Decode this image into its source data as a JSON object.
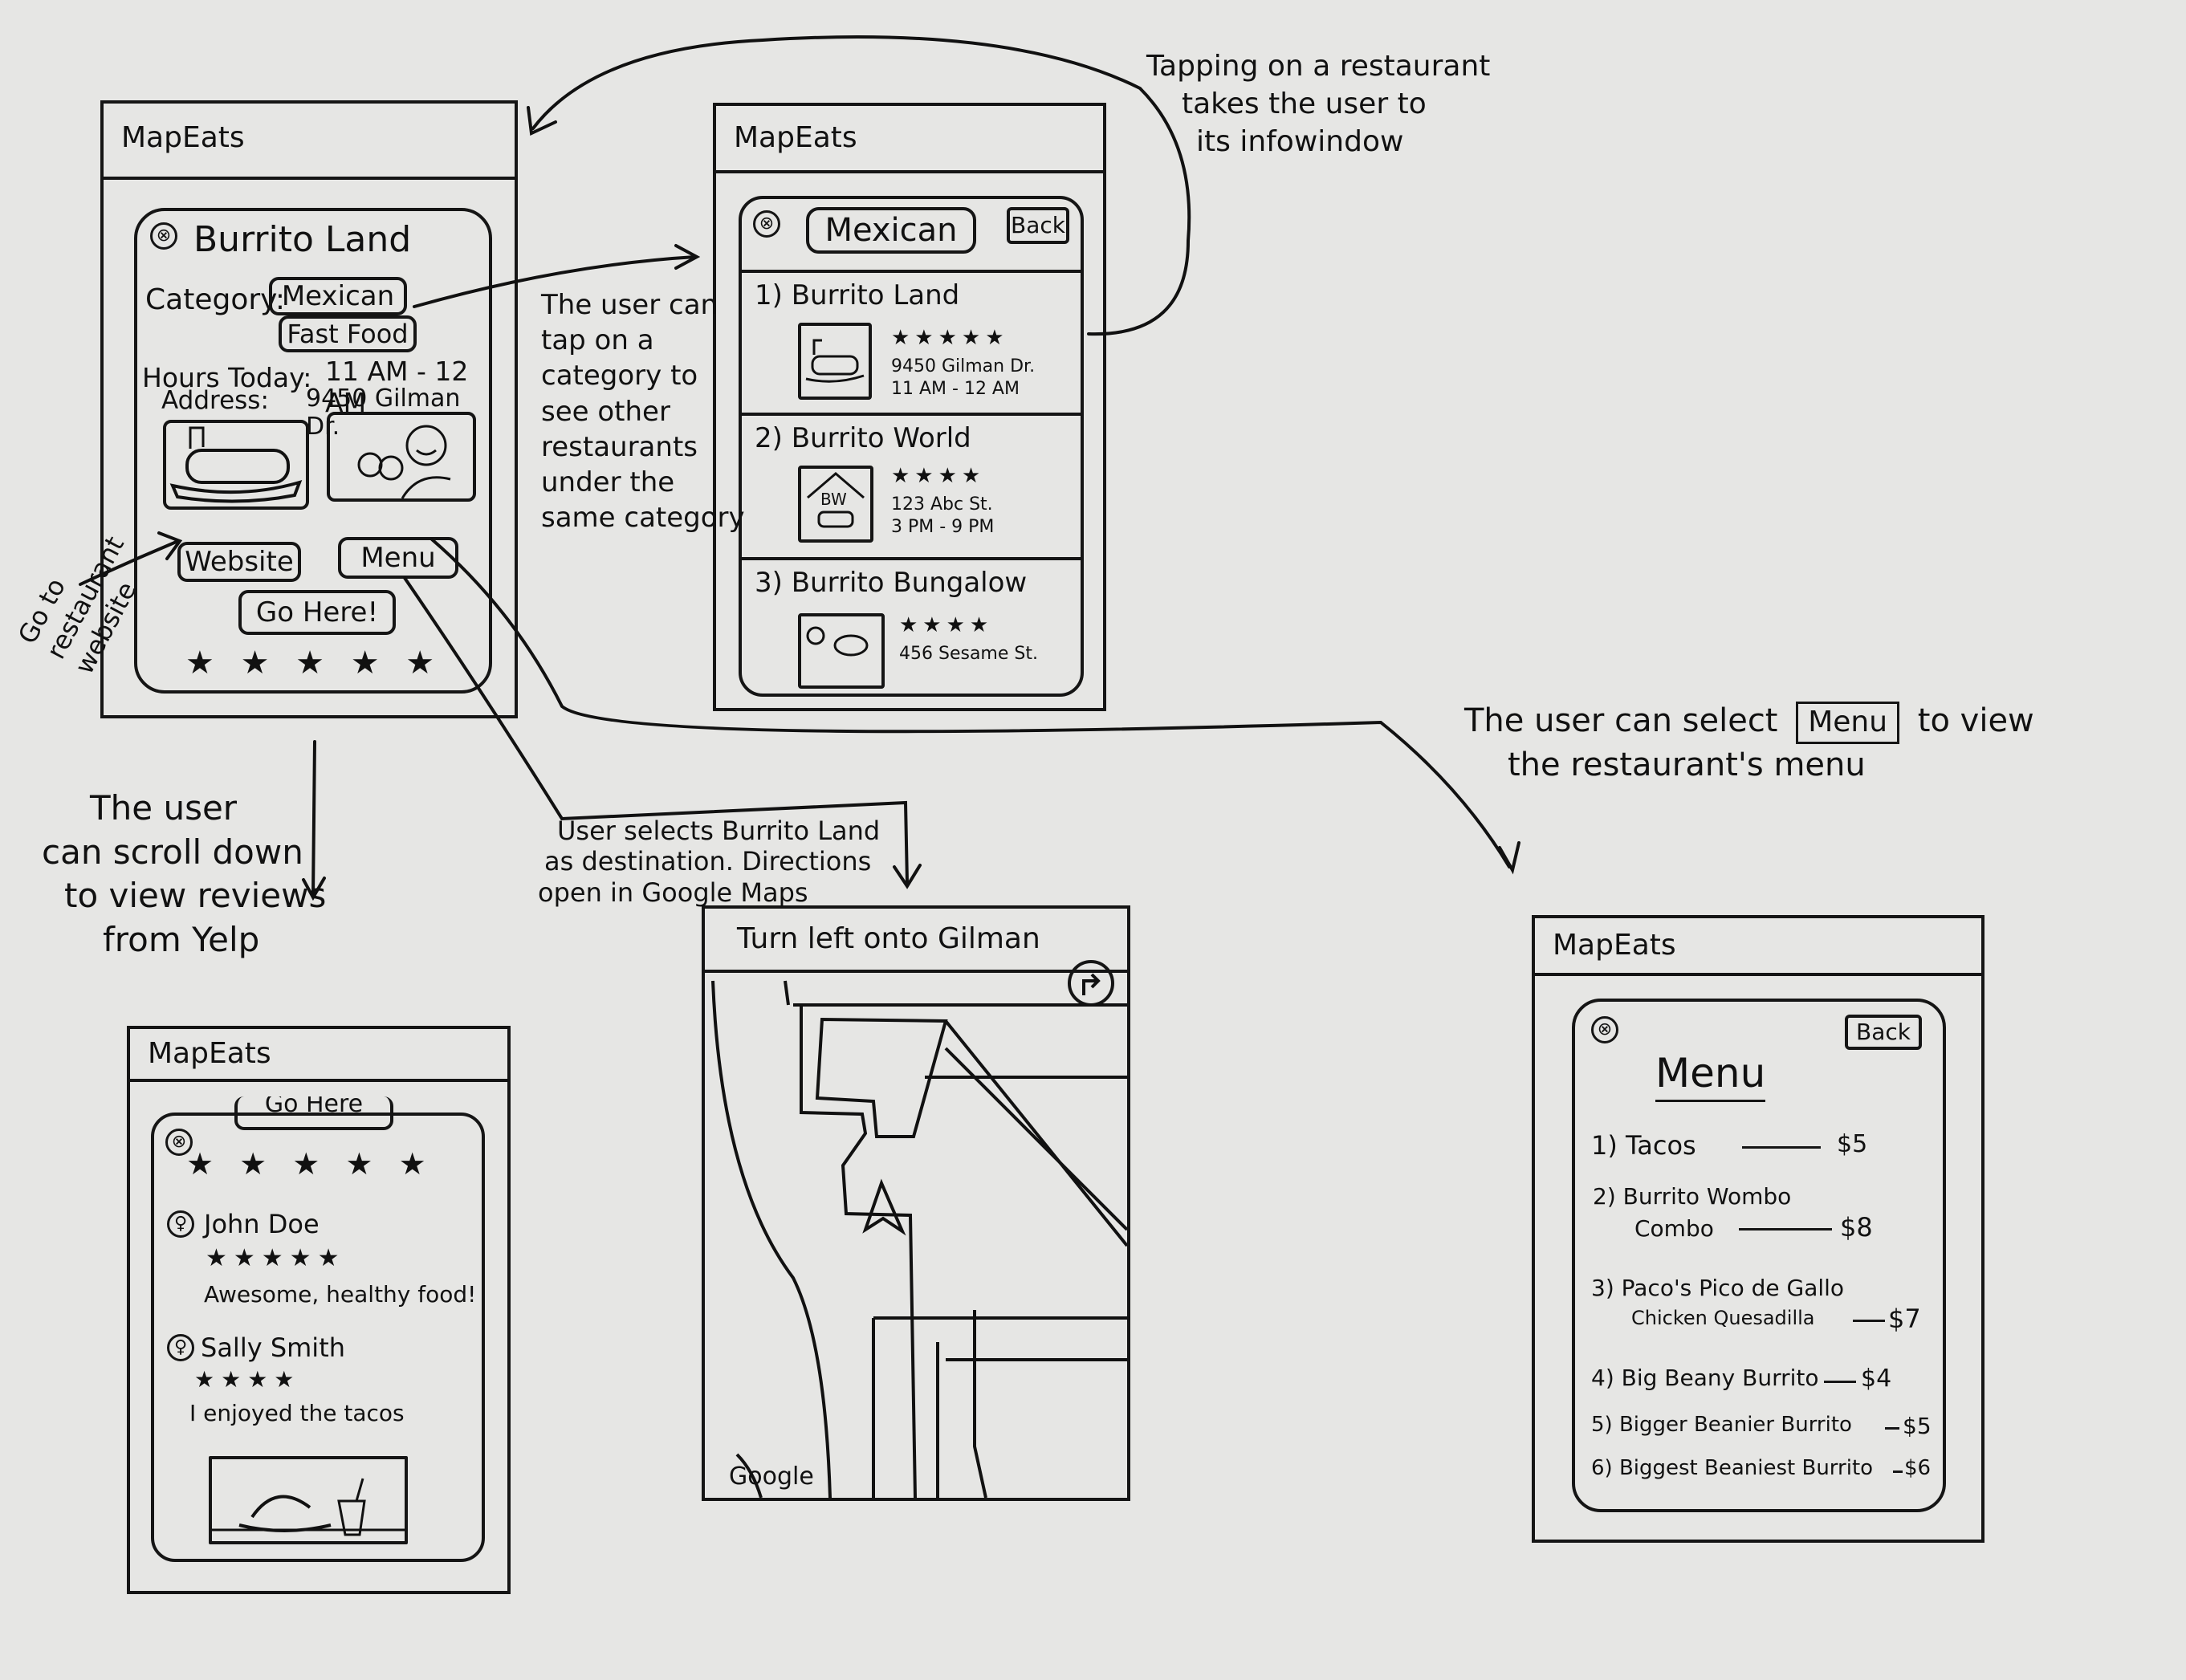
{
  "app_name": "MapEats",
  "screen_info": {
    "title": "Burrito Land",
    "category_label": "Category:",
    "categories": [
      "Mexican",
      "Fast Food"
    ],
    "hours_label": "Hours Today:",
    "hours_value": "11 AM - 12 AM",
    "address_label": "Address:",
    "address_value": "9450 Gilman Dr.",
    "website_button": "Website",
    "menu_button": "Menu",
    "go_here_button": "Go Here!",
    "stars": "★ ★ ★ ★ ★",
    "close_glyph": "⊗"
  },
  "screen_category": {
    "category": "Mexican",
    "back_button": "Back",
    "close_glyph": "⊗",
    "restaurants": [
      {
        "name": "1) Burrito Land",
        "stars": "★★★★★",
        "address": "9450 Gilman Dr.",
        "hours": "11 AM - 12 AM"
      },
      {
        "name": "2) Burrito World",
        "stars": "★★★★",
        "address": "123 Abc St.",
        "hours": "3 PM - 9 PM",
        "logo": "BW"
      },
      {
        "name": "3) Burrito Bungalow",
        "stars": "★★★★",
        "address": "456 Sesame St."
      }
    ]
  },
  "screen_reviews": {
    "partial_button": "Go Here",
    "stars": "★ ★ ★ ★ ★",
    "close_glyph": "⊗",
    "reviews": [
      {
        "name": "John Doe",
        "stars": "★★★★★",
        "text": "Awesome, healthy food!"
      },
      {
        "name": "Sally Smith",
        "stars": "★★★★",
        "text": "I enjoyed the tacos"
      }
    ]
  },
  "screen_directions": {
    "instruction": "Turn left onto Gilman",
    "map_brand": "Google"
  },
  "screen_menu": {
    "title": "Menu",
    "back_button": "Back",
    "close_glyph": "⊗",
    "items": [
      {
        "label": "1) Tacos",
        "price": "$5"
      },
      {
        "label": "2) Burrito Wombo",
        "label2": "Combo",
        "price": "$8"
      },
      {
        "label": "3) Paco's Pico de Gallo",
        "label2": "Chicken Quesadilla",
        "price": "$7"
      },
      {
        "label": "4) Big Beany Burrito",
        "price": "$4"
      },
      {
        "label": "5) Bigger Beanier Burrito",
        "price": "$5"
      },
      {
        "label": "6) Biggest Beaniest Burrito",
        "price": "$6"
      }
    ]
  },
  "annotations": {
    "tap_restaurant": [
      "Tapping on a restaurant",
      "takes the user to",
      "its infowindow"
    ],
    "tap_category": [
      "The user can",
      "tap on a",
      "category to",
      "see other",
      "restaurants",
      "under the",
      "same category"
    ],
    "website": [
      "Go to",
      "restaurant",
      "website"
    ],
    "scroll": [
      "The user",
      "can scroll down",
      "to view reviews",
      "from Yelp"
    ],
    "go_here": [
      "User selects Burrito Land",
      "as destination. Directions",
      "open in Google Maps"
    ],
    "menu_pre": "The user can select",
    "menu_boxed": "Menu",
    "menu_post": "to view",
    "menu_line2": "the restaurant's menu"
  }
}
